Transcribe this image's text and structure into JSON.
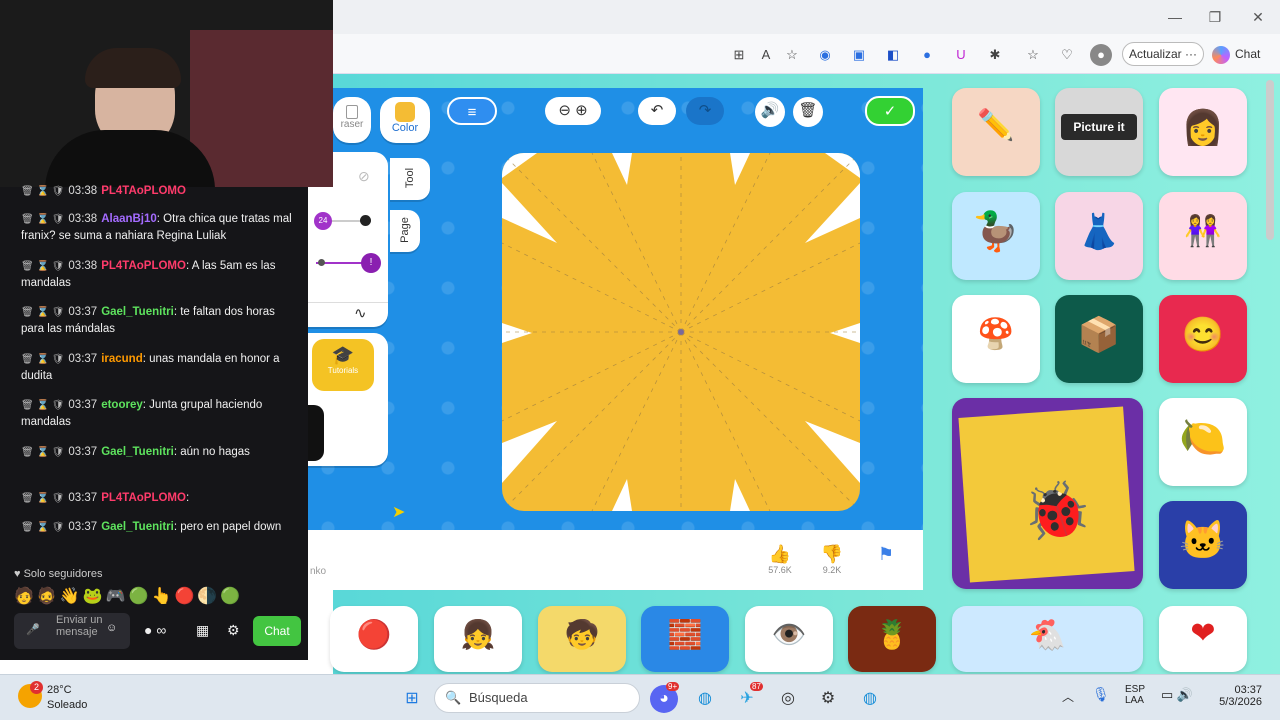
{
  "window": {
    "minimize": "—",
    "maximize": "❐",
    "close": "✕"
  },
  "toolbar": {
    "update_label": "Actualizar",
    "more": "···",
    "chat_label": "Chat"
  },
  "game": {
    "tools": {
      "eraser": "raser",
      "color": "Color",
      "tool": "Tool",
      "page": "Page",
      "tutorials": "Tutorials",
      "size_value": "24"
    },
    "colors": {
      "accent": "#1f8fe6",
      "canvas": "#f4bc34",
      "confirm": "#33d133"
    }
  },
  "likes": {
    "likes_count": "57.6K",
    "dislikes_count": "9.2K",
    "author": "nko"
  },
  "chat": {
    "messages": [
      {
        "time": "03:38",
        "user": "PL4TAoPLOMO",
        "user_color": "#ff3b6b",
        "text": ""
      },
      {
        "time": "03:38",
        "user": "AlaanBj10",
        "user_color": "#a46bff",
        "text": ": Otra chica que tratas mal franix? se suma a nahiara Regina Luliak"
      },
      {
        "time": "03:38",
        "user": "PL4TAoPLOMO",
        "user_color": "#ff3b6b",
        "text": ": A las 5am es las mandalas"
      },
      {
        "time": "03:37",
        "user": "Gael_Tuenitri",
        "user_color": "#5ee35e",
        "text": ": te faltan dos horas para las mándalas"
      },
      {
        "time": "03:37",
        "user": "iracund",
        "user_color": "#ff9a00",
        "text": ": unas mandala en honor a dudita"
      },
      {
        "time": "03:37",
        "user": "etoorey",
        "user_color": "#5ee35e",
        "text": ": Junta grupal haciendo mandalas"
      },
      {
        "time": "03:37",
        "user": "Gael_Tuenitri",
        "user_color": "#5ee35e",
        "text": ": aún no hagas"
      },
      {
        "time": "03:37",
        "user": "PL4TAoPLOMO",
        "user_color": "#ff3b6b",
        "text": ":"
      },
      {
        "time": "03:37",
        "user": "Gael_Tuenitri",
        "user_color": "#5ee35e",
        "text": ": pero en papel down"
      }
    ],
    "followers_only": "Solo seguidores",
    "input_placeholder": "Enviar un mensaje",
    "send_label": "Chat"
  },
  "taskbar": {
    "weather_temp": "28°C",
    "weather_desc": "Soleado",
    "search_placeholder": "Búsqueda",
    "lang_top": "ESP",
    "lang_bottom": "LAA",
    "time": "03:37",
    "date": "5/3/2026",
    "notif_badge": "2",
    "teams_badge": "9+",
    "telegram_badge": "87"
  },
  "thumbs": {
    "picture_it": "Picture it"
  }
}
